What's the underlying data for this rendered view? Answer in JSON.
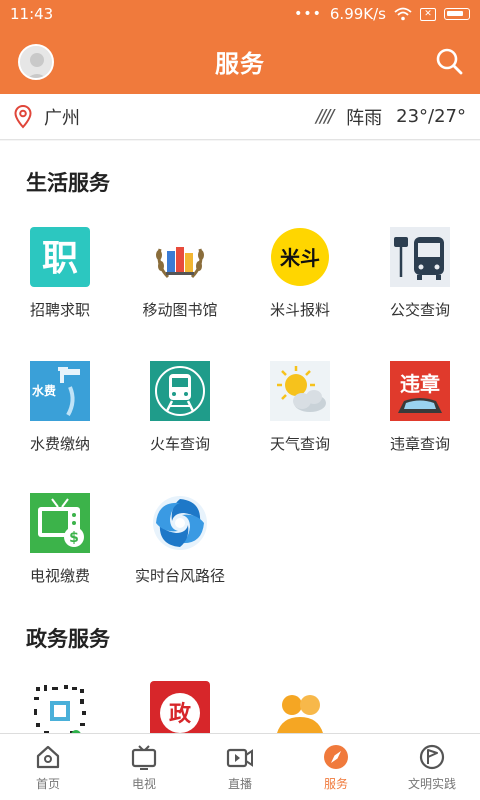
{
  "status_bar": {
    "time": "11:43",
    "speed": "6.99K/s"
  },
  "app_bar": {
    "title": "服务"
  },
  "weather": {
    "city": "广州",
    "rain_symbol": "////",
    "condition": "阵雨",
    "temperature": "23°/27°"
  },
  "sections": [
    {
      "title": "生活服务",
      "items": [
        {
          "label": "招聘求职",
          "icon": "job-icon"
        },
        {
          "label": "移动图书馆",
          "icon": "library-icon"
        },
        {
          "label": "米斗报料",
          "icon": "midou-icon"
        },
        {
          "label": "公交查询",
          "icon": "bus-icon"
        },
        {
          "label": "水费缴纳",
          "icon": "water-fee-icon"
        },
        {
          "label": "火车查询",
          "icon": "train-icon"
        },
        {
          "label": "天气查询",
          "icon": "weather-icon"
        },
        {
          "label": "违章查询",
          "icon": "traffic-violation-icon"
        },
        {
          "label": "电视缴费",
          "icon": "tv-fee-icon"
        },
        {
          "label": "实时台风路径",
          "icon": "typhoon-icon"
        }
      ]
    },
    {
      "title": "政务服务",
      "items": [
        {
          "label": "",
          "icon": "qr-code-icon"
        },
        {
          "label": "",
          "icon": "government-icon"
        },
        {
          "label": "",
          "icon": "people-icon"
        }
      ]
    }
  ],
  "icon_texts": {
    "job": "职",
    "midou": "米斗",
    "water": "水费",
    "gov": "政",
    "violation": "违章"
  },
  "tab_bar": {
    "active_index": 3,
    "tabs": [
      {
        "label": "首页",
        "icon": "home-icon"
      },
      {
        "label": "电视",
        "icon": "tv-icon"
      },
      {
        "label": "直播",
        "icon": "live-icon"
      },
      {
        "label": "服务",
        "icon": "compass-icon"
      },
      {
        "label": "文明实践",
        "icon": "flag-icon"
      }
    ]
  },
  "colors": {
    "brand": "#f07a3c",
    "active_tab": "#f07a3c"
  }
}
